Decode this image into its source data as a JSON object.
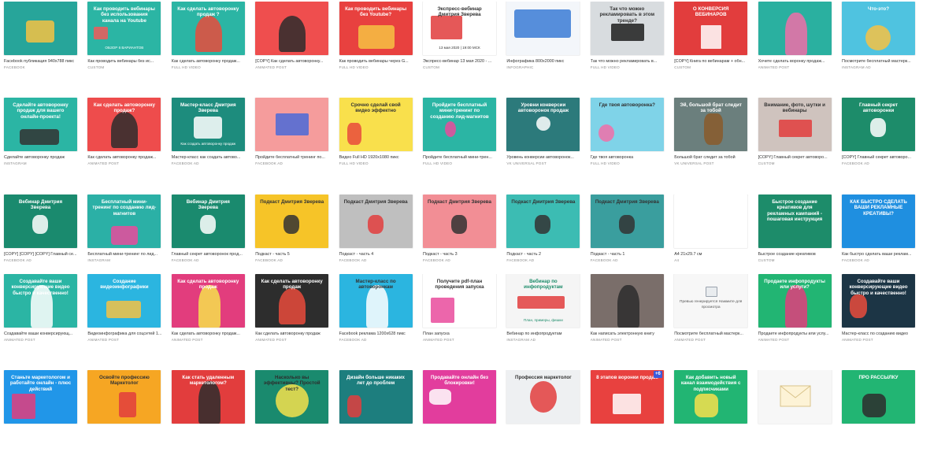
{
  "grid": {
    "cards": [
      {
        "title": "Facebook публикация 940х788 пикс",
        "type": "FACEBOOK",
        "bg": "#27a59a",
        "label": "",
        "label_color": "#ffffff",
        "accent": "#f6c243",
        "art": "robot"
      },
      {
        "title": "Как проводить вебинары без ис...",
        "type": "CUSTOM",
        "bg": "#2bb5a4",
        "label": "Как проводить вебинары без использования канала на Youtube",
        "label_color": "#ffffff",
        "sub": "ОБЗОР 6 ВАРИАНТОВ",
        "accent": "#f05a5a",
        "art": "clapper"
      },
      {
        "title": "Как сделать автоворонку продаж...",
        "type": "FULL HD VIDEO",
        "bg": "#2bb5a4",
        "label": "Как сделать автоворонку продаж ?",
        "label_color": "#ffffff",
        "accent": "#e94b3c",
        "art": "girl"
      },
      {
        "title": "[COPY] Как сделать автоворонку...",
        "type": "ANIMATED POST",
        "bg": "#ef4e4e",
        "label": "",
        "label_color": "#ffffff",
        "accent": "#2d2d2d",
        "art": "girl"
      },
      {
        "title": "Как проводить вебинары через G...",
        "type": "FULL HD VIDEO",
        "bg": "#e8413f",
        "label": "Как проводить вебинары без Youtube?",
        "label_color": "#ffffff",
        "accent": "#f6c243",
        "art": "desk"
      },
      {
        "title": "Экспресс-вебинар 13 мая 2020 - ...",
        "type": "CUSTOM",
        "bg": "#ffffff",
        "label": "Экспресс-вебинар Дмитрия Зверева",
        "label_color": "#333333",
        "sub": "13 мая 2020 | 19:00 МСК",
        "accent": "#e03b3b",
        "art": "screen"
      },
      {
        "title": "Инфографика 800х2000 пикс",
        "type": "INFOGRAPHIC",
        "bg": "#f3f6fa",
        "label": "",
        "label_color": "#333333",
        "accent": "#3a7bd5",
        "art": "map"
      },
      {
        "title": "Так что можно рекламировать в...",
        "type": "FULL HD VIDEO",
        "bg": "#d8dcdf",
        "label": "Так что можно рекламировать в этом тренде?",
        "label_color": "#333333",
        "accent": "#1e1e1e",
        "art": "laptop"
      },
      {
        "title": "[COPY] Книга по вебинарам + обн...",
        "type": "CUSTOM",
        "bg": "#e23d3d",
        "label": "О КОНВЕРСИЯ ВЕБИНАРОВ",
        "label_color": "#ffffff",
        "accent": "#ffffff",
        "art": "book"
      },
      {
        "title": "Хочете сделать воронку продаж...",
        "type": "ANIMATED POST",
        "bg": "#2ab0a0",
        "label": "",
        "label_color": "#ffffff",
        "accent": "#f06fa8",
        "art": "woman"
      },
      {
        "title": "Посмотрите бесплатный мастерк...",
        "type": "INSTAGRAM AD",
        "bg": "#4fc3e0",
        "label": "Что-это?",
        "label_color": "#ffffff",
        "accent": "#f6c243",
        "art": "cartoon"
      },
      {
        "title": "Сделайте автоворонку продаж",
        "type": "INSTAGRAM",
        "bg": "#2bb5a4",
        "label": "Сделайте автоворонку продаж для вашего онлайн-проекта!",
        "label_color": "#ffffff",
        "accent": "#333333",
        "art": "people"
      },
      {
        "title": "Как сделать автоворонку продаж...",
        "type": "ANIMATED POST",
        "bg": "#ee4c4c",
        "label": "Как сделать автоворонку продаж?",
        "label_color": "#ffffff",
        "accent": "#2d2d2d",
        "art": "girl"
      },
      {
        "title": "Мастер-класс как создать автово...",
        "type": "FACEBOOK AD",
        "bg": "#1d8c7d",
        "label": "Мастер-класс Дмитрия Зверева",
        "label_color": "#ffffff",
        "sub": "Как создать автоворонку продаж",
        "accent": "#ffffff",
        "art": "robot"
      },
      {
        "title": "Пройдите бесплатный тренинг по...",
        "type": "FACEBOOK AD",
        "bg": "#f59c9c",
        "label": "",
        "label_color": "#333333",
        "accent": "#4a6ad8",
        "art": "monitor"
      },
      {
        "title": "Видео Full HD 1920х1080 пикс",
        "type": "FULL HD VIDEO",
        "bg": "#f9e04c",
        "label": "Срочно сделай свой видео эффектно",
        "label_color": "#333333",
        "accent": "#e94b3c",
        "art": "runner"
      },
      {
        "title": "Пройдите бесплатный мини-трен...",
        "type": "FULL HD VIDEO",
        "bg": "#2bb5a4",
        "label": "Пройдите бесплатный мини-тренинг по созданию лид-магнитов",
        "label_color": "#ffffff",
        "accent": "#e94b9c",
        "art": "eggs"
      },
      {
        "title": "Уровень конверсии автоворонок...",
        "type": "VK UNIVERSAL POST",
        "bg": "#2c7a7b",
        "label": "Уровни конверсии автоворонок продаж",
        "label_color": "#ffffff",
        "accent": "#ffffff",
        "art": "diagram"
      },
      {
        "title": "Где твоя автоворонка",
        "type": "FULL HD VIDEO",
        "bg": "#7fd3e8",
        "label": "Где твоя автоворонка?",
        "label_color": "#333333",
        "accent": "#f06fa8",
        "art": "bird"
      },
      {
        "title": "Большой брат следит за тобой",
        "type": "VK UNIVERSAL POST",
        "bg": "#6b7f7d",
        "label": "Эй, большой брат следит за тобой",
        "label_color": "#ffffff",
        "accent": "#8a5a2a",
        "art": "deer"
      },
      {
        "title": "[COPY] Главный секрет автоворо...",
        "type": "CUSTOM",
        "bg": "#cfc3be",
        "label": "Внимание, фото, шутки и вебинары",
        "label_color": "#333333",
        "accent": "#e23d3d",
        "art": "laptop"
      },
      {
        "title": "[COPY] Главный секрет автоворо...",
        "type": "FACEBOOK AD",
        "bg": "#1d8c6a",
        "label": "Главный секрет автоворонки",
        "label_color": "#ffffff",
        "accent": "#ffffff",
        "art": "mic"
      },
      {
        "title": "[COPY] [COPY] [COPY] Главный се...",
        "type": "FACEBOOK AD",
        "bg": "#1a8a6e",
        "label": "Вебинар Дмитрия Зверева",
        "label_color": "#ffffff",
        "accent": "#ffffff",
        "art": "mic"
      },
      {
        "title": "Бесплатный мини-тренинг по лид...",
        "type": "INSTAGRAM",
        "bg": "#2bb0a6",
        "label": "Бесплатный мини-тренинг по созданию лид-магнитов",
        "label_color": "#ffffff",
        "accent": "#e94b9c",
        "art": "tree"
      },
      {
        "title": "Главный секрет автоворонок прод...",
        "type": "FACEBOOK AD",
        "bg": "#1a8a6e",
        "label": "Вебинар Дмитрия Зверева",
        "label_color": "#ffffff",
        "accent": "#ffffff",
        "art": "mic"
      },
      {
        "title": "Подкаст - часть 5",
        "type": "FACEBOOK AD",
        "bg": "#f6c428",
        "label": "Подкаст Дмитрия Зверева",
        "label_color": "#333333",
        "accent": "#333333",
        "art": "mic"
      },
      {
        "title": "Подкаст - часть 4",
        "type": "FACEBOOK AD",
        "bg": "#bfbfbf",
        "label": "Подкаст Дмитрия Зверева",
        "label_color": "#333333",
        "accent": "#e23d3d",
        "art": "mic"
      },
      {
        "title": "Подкаст - часть 3",
        "type": "FACEBOOK AD",
        "bg": "#f28e95",
        "label": "Подкаст Дмитрия Зверева",
        "label_color": "#333333",
        "accent": "#333333",
        "art": "mic"
      },
      {
        "title": "Подкаст - часть 2",
        "type": "FACEBOOK AD",
        "bg": "#3cbcb3",
        "label": "Подкаст Дмитрия Зверева",
        "label_color": "#333333",
        "accent": "#333333",
        "art": "mic"
      },
      {
        "title": "Подкаст - часть 1",
        "type": "FACEBOOK AD",
        "bg": "#3a9e9e",
        "label": "Подкаст Дмитрия Зверева",
        "label_color": "#333333",
        "accent": "#333333",
        "art": "mic"
      },
      {
        "title": "A4 21х29.7 см",
        "type": "A4",
        "bg": "#ffffff",
        "label": "",
        "label_color": "#333333",
        "accent": "#cccccc",
        "art": "blank"
      },
      {
        "title": "Быстрое создание креативов",
        "type": "CUSTOM",
        "bg": "#1d8c6a",
        "label": "Быстрое создание креативов для рекламных кампаний - пошаговая инструкция",
        "label_color": "#ffffff",
        "accent": "#ffffff",
        "art": "text"
      },
      {
        "title": "Как быстро сделать ваши реклам...",
        "type": "FACEBOOK AD",
        "bg": "#1f8fe0",
        "label": "КАК БЫСТРО СДЕЛАТЬ ВАШИ РЕКЛАМНЫЕ КРЕАТИВЫ?",
        "label_color": "#ffffff",
        "accent": "#e23d3d",
        "art": "text"
      },
      {
        "title": "Создавайте ваши конверсирующ...",
        "type": "ANIMATED POST",
        "bg": "#2bb5a4",
        "label": "Создавайте ваши конверсирующие видео быстро и качественно!",
        "label_color": "#ffffff",
        "accent": "#ffffff",
        "art": "woman"
      },
      {
        "title": "Видеоинфографика для соцсетей 1...",
        "type": "ANIMATED POST",
        "bg": "#2bb5e0",
        "label": "Создание видеоинфографики",
        "label_color": "#ffffff",
        "accent": "#f6c243",
        "art": "truck"
      },
      {
        "title": "Как сделать автоворонку продаж...",
        "type": "ANIMATED POST",
        "bg": "#e23d7d",
        "label": "Как сделать автоворонку продаж",
        "label_color": "#ffffff",
        "accent": "#f6e04c",
        "art": "woman"
      },
      {
        "title": "Как сделать автоворонку продаж",
        "type": "ANIMATED POST",
        "bg": "#2d2d2d",
        "label": "Как сделать автоворонку продаж",
        "label_color": "#ffffff",
        "accent": "#e94b3c",
        "art": "girl"
      },
      {
        "title": "Facebook реклама 1200х628 пикс",
        "type": "FACEBOOK AD",
        "bg": "#2bb5e0",
        "label": "Мастер-класс по автоворонкам",
        "label_color": "#333333",
        "accent": "#ffffff",
        "art": "woman"
      },
      {
        "title": "План запуска",
        "type": "ANIMATED POST",
        "bg": "#ffffff",
        "label": "Получите pdf-план проведения запуска",
        "label_color": "#333333",
        "accent": "#e94b9c",
        "art": "books"
      },
      {
        "title": "Вебинар по инфопродуктам",
        "type": "INSTAGRAM AD",
        "bg": "#f5f5f5",
        "label": "Вебинар по инфопродуктам",
        "label_color": "#1d8c6a",
        "sub": "План, примеры, фишки",
        "accent": "#e23d3d",
        "art": "bottles"
      },
      {
        "title": "Как написать электронную книгу",
        "type": "ANIMATED POST",
        "bg": "#7a6e6a",
        "label": "",
        "label_color": "#ffffff",
        "accent": "#2d2d2d",
        "art": "woman"
      },
      {
        "title": "Посмотрите бесплатный мастерк...",
        "type": "ANIMATED POST",
        "bg": "#f7f7f7",
        "label": "Превью генерируется Нажмите для просмотра",
        "label_color": "#555555",
        "accent": "#9aa2ad",
        "art": "placeholder"
      },
      {
        "title": "Продаете инфопродукты или услу...",
        "type": "ANIMATED POST",
        "bg": "#22b573",
        "label": "Продаете инфопродукты или услуги?",
        "label_color": "#ffffff",
        "accent": "#e23d7d",
        "art": "woman"
      },
      {
        "title": "Мастер-класс по созданию видео",
        "type": "ANIMATED POST",
        "bg": "#1c3545",
        "label": "Создавайте ваши конверсирующие видео быстро и качественно!",
        "label_color": "#ffffff",
        "accent": "#e94b3c",
        "art": "rabbit"
      },
      {
        "title": "",
        "type": "",
        "bg": "#2196e8",
        "label": "Станьте маркетологом и работайте онлайн - плюс действий",
        "label_color": "#ffffff",
        "accent": "#e23d7d",
        "art": "books"
      },
      {
        "title": "",
        "type": "",
        "bg": "#f6a623",
        "label": "Освойте профессию Маркетолог",
        "label_color": "#333333",
        "accent": "#e23d3d",
        "art": "suitcase"
      },
      {
        "title": "",
        "type": "",
        "bg": "#e23d3d",
        "label": "Как стать удаленным маркетологом?",
        "label_color": "#ffffff",
        "accent": "#2d2d2d",
        "art": "woman"
      },
      {
        "title": "",
        "type": "",
        "bg": "#1a8a6e",
        "label": "Насколько вы эффективны? Простой тест?",
        "label_color": "#2d2d2d",
        "accent": "#f6e04c",
        "art": "badge"
      },
      {
        "title": "",
        "type": "",
        "bg": "#1d7e7e",
        "label": "Дизайн больше никаких лет до проблем",
        "label_color": "#ffffff",
        "accent": "#e23d3d",
        "art": "runner"
      },
      {
        "title": "",
        "type": "",
        "bg": "#e23d9d",
        "label": "Продавайте онлайн без блокировки!",
        "label_color": "#ffffff",
        "accent": "#ffffff",
        "art": "megaphone"
      },
      {
        "title": "",
        "type": "",
        "bg": "#eef0f2",
        "label": "Профессия маркетолог",
        "label_color": "#333333",
        "accent": "#e23d3d",
        "art": "oldman"
      },
      {
        "title": "",
        "type": "",
        "bg": "#e8413f",
        "label": "8 этапов воронки продаж",
        "label_color": "#ffffff",
        "accent": "#ffffff",
        "art": "chart",
        "badge": "+6"
      },
      {
        "title": "",
        "type": "",
        "bg": "#22b573",
        "label": "Как добавить новый канал взаимодействия с подписчиками",
        "label_color": "#ffffff",
        "accent": "#f6e04c",
        "art": "person"
      },
      {
        "title": "",
        "type": "",
        "bg": "#f7f7f7",
        "label": "",
        "label_color": "#333333",
        "accent": "#f2dfa8",
        "art": "envelope"
      },
      {
        "title": "",
        "type": "",
        "bg": "#22b573",
        "label": "ПРО РАССЫЛКУ",
        "label_color": "#ffffff",
        "accent": "#2d2d2d",
        "art": "person"
      }
    ]
  }
}
